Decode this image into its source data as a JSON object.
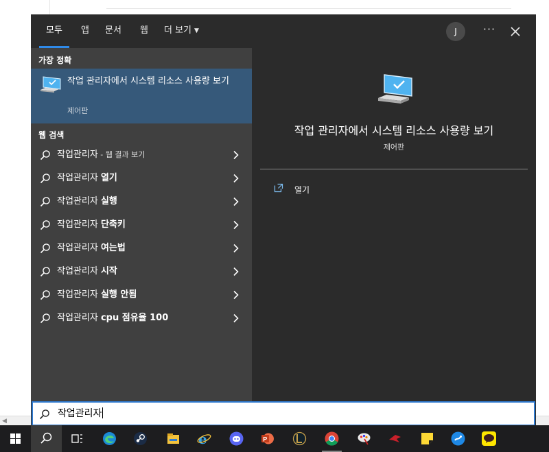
{
  "tabs": [
    {
      "label": "모두"
    },
    {
      "label": "앱"
    },
    {
      "label": "문서"
    },
    {
      "label": "웹"
    },
    {
      "label": "더 보기"
    }
  ],
  "account": {
    "initial": "J"
  },
  "header": {
    "more_glyph": "···"
  },
  "best_match": {
    "heading": "가장 정확",
    "title": "작업 관리자에서 시스템 리소스 사용량 보기",
    "subtitle": "제어판",
    "icon": "monitor-icon"
  },
  "web_search": {
    "heading": "웹 검색",
    "items": [
      {
        "prefix": "작업관리자",
        "bold": "",
        "suffix": " - 웹 결과 보기"
      },
      {
        "prefix": "작업관리자 ",
        "bold": "열기",
        "suffix": ""
      },
      {
        "prefix": "작업관리자 ",
        "bold": "실행",
        "suffix": ""
      },
      {
        "prefix": "작업관리자 ",
        "bold": "단축키",
        "suffix": ""
      },
      {
        "prefix": "작업관리자 ",
        "bold": "여는법",
        "suffix": ""
      },
      {
        "prefix": "작업관리자 ",
        "bold": "시작",
        "suffix": ""
      },
      {
        "prefix": "작업관리자 ",
        "bold": "실행 안됨",
        "suffix": ""
      },
      {
        "prefix": "작업관리자 ",
        "bold": "cpu 점유율 100",
        "suffix": ""
      }
    ]
  },
  "detail": {
    "title": "작업 관리자에서 시스템 리소스 사용량 보기",
    "subtitle": "제어판",
    "action_label": "열기"
  },
  "search": {
    "value": "작업관리자"
  },
  "taskbar": {
    "items": [
      "windows-start-icon",
      "search-icon",
      "task-view-icon",
      "edge-icon",
      "steam-icon",
      "file-explorer-icon",
      "internet-explorer-icon",
      "discord-icon",
      "powerpoint-icon",
      "league-of-legends-icon",
      "chrome-icon",
      "paint-icon",
      "red-app-icon",
      "sticky-notes-icon",
      "blue-app-icon",
      "kakaotalk-icon"
    ]
  },
  "colors": {
    "accent": "#2f8ae8",
    "best_match_bg": "#36597a",
    "panel_bg": "#2b2b2b",
    "list_bg": "#404040"
  }
}
